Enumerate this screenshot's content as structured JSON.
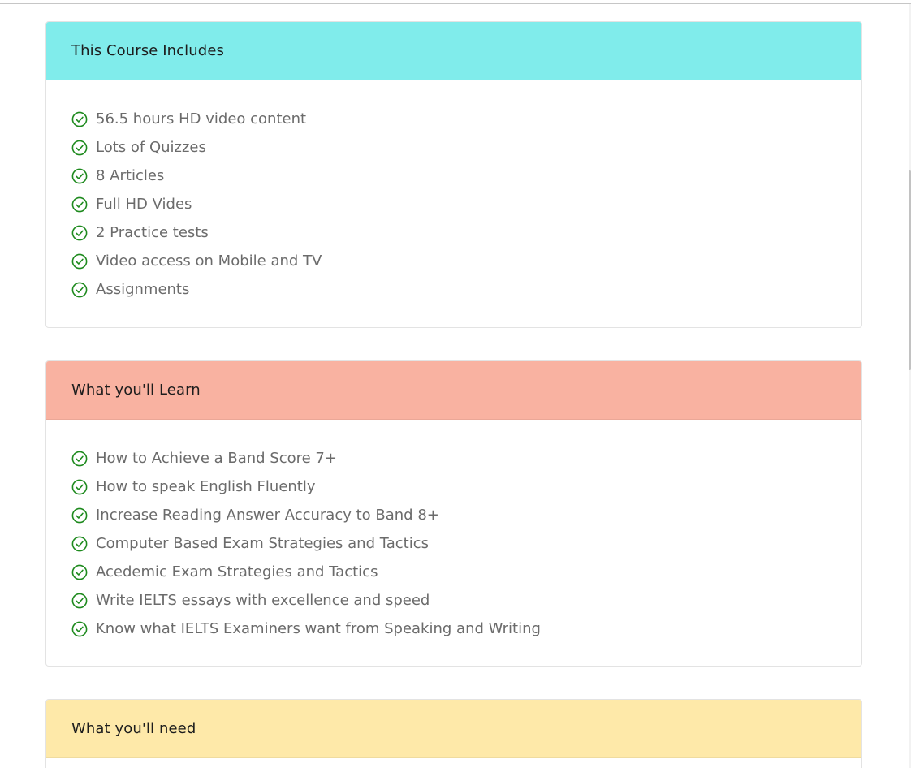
{
  "colors": {
    "includes_header": "#80eceb",
    "learn_header": "#f9b2a1",
    "need_header": "#fee9a9",
    "check_green": "#1e8a1e"
  },
  "icons": {
    "list_bullet": "check-circle-icon"
  },
  "includes": {
    "title": "This Course Includes",
    "items": [
      "56.5 hours HD video content",
      "Lots of Quizzes",
      "8 Articles",
      "Full HD Vides",
      "2 Practice tests",
      "Video access on Mobile and TV",
      "Assignments"
    ]
  },
  "learn": {
    "title": "What you'll Learn",
    "items": [
      "How to Achieve a Band Score 7+",
      "How to speak English Fluently",
      "Increase Reading Answer Accuracy to Band 8+",
      "Computer Based Exam Strategies and Tactics",
      "Acedemic Exam Strategies and Tactics",
      "Write IELTS essays with excellence and speed",
      "Know what IELTS Examiners want from Speaking and Writing"
    ]
  },
  "need": {
    "title": "What you'll need"
  }
}
